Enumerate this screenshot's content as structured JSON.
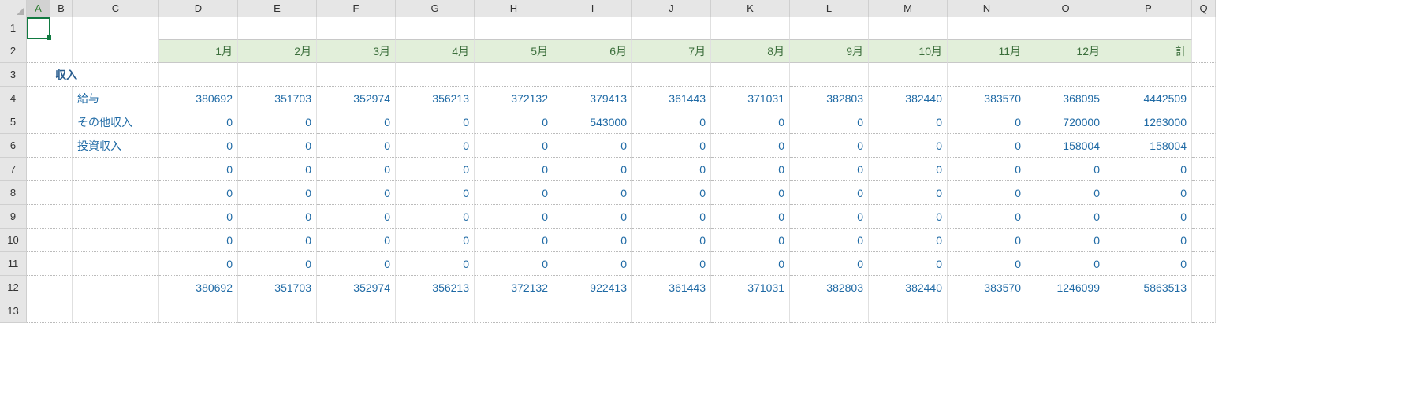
{
  "chart_data": {
    "type": "table",
    "title": "収入",
    "columns": [
      "1月",
      "2月",
      "3月",
      "4月",
      "5月",
      "6月",
      "7月",
      "8月",
      "9月",
      "10月",
      "11月",
      "12月",
      "計"
    ],
    "rows": [
      {
        "label": "給与",
        "values": [
          380692,
          351703,
          352974,
          356213,
          372132,
          379413,
          361443,
          371031,
          382803,
          382440,
          383570,
          368095,
          4442509
        ]
      },
      {
        "label": "その他収入",
        "values": [
          0,
          0,
          0,
          0,
          0,
          543000,
          0,
          0,
          0,
          0,
          0,
          720000,
          1263000
        ]
      },
      {
        "label": "投資収入",
        "values": [
          0,
          0,
          0,
          0,
          0,
          0,
          0,
          0,
          0,
          0,
          0,
          158004,
          158004
        ]
      },
      {
        "label": "",
        "values": [
          0,
          0,
          0,
          0,
          0,
          0,
          0,
          0,
          0,
          0,
          0,
          0,
          0
        ]
      },
      {
        "label": "",
        "values": [
          0,
          0,
          0,
          0,
          0,
          0,
          0,
          0,
          0,
          0,
          0,
          0,
          0
        ]
      },
      {
        "label": "",
        "values": [
          0,
          0,
          0,
          0,
          0,
          0,
          0,
          0,
          0,
          0,
          0,
          0,
          0
        ]
      },
      {
        "label": "",
        "values": [
          0,
          0,
          0,
          0,
          0,
          0,
          0,
          0,
          0,
          0,
          0,
          0,
          0
        ]
      },
      {
        "label": "",
        "values": [
          0,
          0,
          0,
          0,
          0,
          0,
          0,
          0,
          0,
          0,
          0,
          0,
          0
        ]
      }
    ],
    "totals": [
      380692,
      351703,
      352974,
      356213,
      372132,
      922413,
      361443,
      371031,
      382803,
      382440,
      383570,
      1246099,
      5863513
    ]
  },
  "columns": [
    "A",
    "B",
    "C",
    "D",
    "E",
    "F",
    "G",
    "H",
    "I",
    "J",
    "K",
    "L",
    "M",
    "N",
    "O",
    "P",
    "Q"
  ],
  "rows": [
    "1",
    "2",
    "3",
    "4",
    "5",
    "6",
    "7",
    "8",
    "9",
    "10",
    "11",
    "12",
    "13"
  ],
  "section_label": "収入",
  "month_headers": [
    "1月",
    "2月",
    "3月",
    "4月",
    "5月",
    "6月",
    "7月",
    "8月",
    "9月",
    "10月",
    "11月",
    "12月",
    "計"
  ],
  "categories": {
    "r4": "給与",
    "r5": "その他収入",
    "r6": "投資収入"
  },
  "data": {
    "r4": [
      "380692",
      "351703",
      "352974",
      "356213",
      "372132",
      "379413",
      "361443",
      "371031",
      "382803",
      "382440",
      "383570",
      "368095",
      "4442509"
    ],
    "r5": [
      "0",
      "0",
      "0",
      "0",
      "0",
      "543000",
      "0",
      "0",
      "0",
      "0",
      "0",
      "720000",
      "1263000"
    ],
    "r6": [
      "0",
      "0",
      "0",
      "0",
      "0",
      "0",
      "0",
      "0",
      "0",
      "0",
      "0",
      "158004",
      "158004"
    ],
    "r7": [
      "0",
      "0",
      "0",
      "0",
      "0",
      "0",
      "0",
      "0",
      "0",
      "0",
      "0",
      "0",
      "0"
    ],
    "r8": [
      "0",
      "0",
      "0",
      "0",
      "0",
      "0",
      "0",
      "0",
      "0",
      "0",
      "0",
      "0",
      "0"
    ],
    "r9": [
      "0",
      "0",
      "0",
      "0",
      "0",
      "0",
      "0",
      "0",
      "0",
      "0",
      "0",
      "0",
      "0"
    ],
    "r10": [
      "0",
      "0",
      "0",
      "0",
      "0",
      "0",
      "0",
      "0",
      "0",
      "0",
      "0",
      "0",
      "0"
    ],
    "r11": [
      "0",
      "0",
      "0",
      "0",
      "0",
      "0",
      "0",
      "0",
      "0",
      "0",
      "0",
      "0",
      "0"
    ],
    "r12": [
      "380692",
      "351703",
      "352974",
      "356213",
      "372132",
      "922413",
      "361443",
      "371031",
      "382803",
      "382440",
      "383570",
      "1246099",
      "5863513"
    ]
  },
  "active_cell": "A1"
}
